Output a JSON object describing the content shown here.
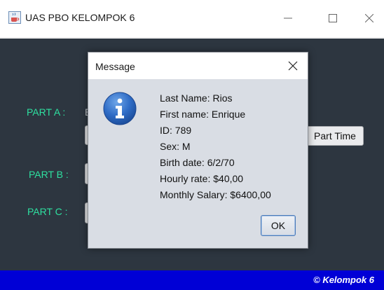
{
  "window": {
    "title": "UAS PBO KELOMPOK 6",
    "icons": {
      "app": "java-cup-icon",
      "minimize": "minimize-icon",
      "maximize": "maximize-icon",
      "close": "close-icon"
    }
  },
  "main": {
    "part_a_label": "PART A :",
    "part_a_partial_text": "E",
    "part_b_label": "PART B :",
    "part_c_label": "PART C :",
    "part_time_button": "Part Time"
  },
  "footer": {
    "text": "© Kelompok 6"
  },
  "dialog": {
    "title": "Message",
    "icon": "info-icon",
    "lines": [
      "Last Name: Rios",
      "First name: Enrique",
      "ID: 789",
      "Sex: M",
      "Birth date: 6/2/70",
      "Hourly rate: $40,00",
      "Monthly Salary: $6400,00"
    ],
    "ok_button": "OK"
  },
  "colors": {
    "panel_bg": "#2d3640",
    "label_green": "#2ee0a0",
    "footer_blue": "#0000d6",
    "dialog_bg": "#d9dde4"
  }
}
